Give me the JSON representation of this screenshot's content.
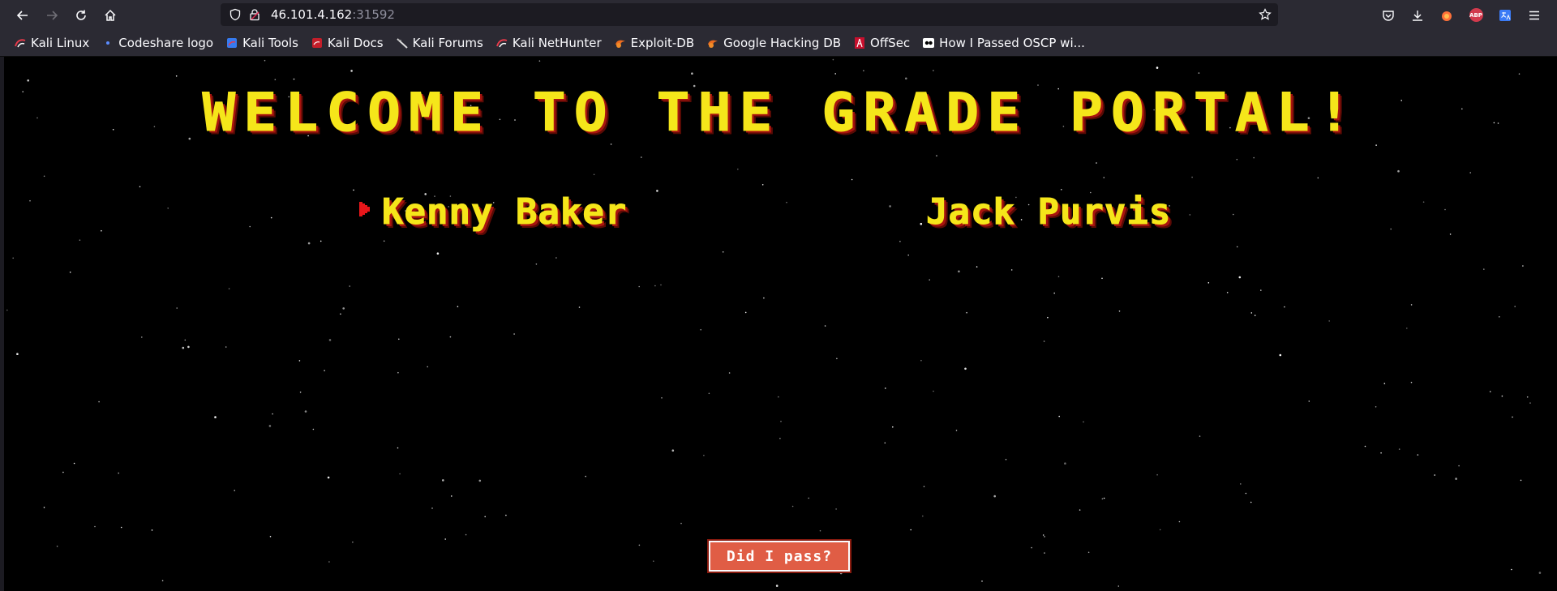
{
  "browser": {
    "url_host": "46.101.4.162",
    "url_port": ":31592",
    "abp_label": "ABP"
  },
  "bookmarks": [
    {
      "label": "Kali Linux",
      "icon": "kali-icon"
    },
    {
      "label": "Codeshare logo",
      "icon": "dot-icon"
    },
    {
      "label": "Kali Tools",
      "icon": "kali-tools-icon"
    },
    {
      "label": "Kali Docs",
      "icon": "kali-docs-icon"
    },
    {
      "label": "Kali Forums",
      "icon": "kali-forums-icon"
    },
    {
      "label": "Kali NetHunter",
      "icon": "kali-icon"
    },
    {
      "label": "Exploit-DB",
      "icon": "exploitdb-icon"
    },
    {
      "label": "Google Hacking DB",
      "icon": "exploitdb-icon"
    },
    {
      "label": "OffSec",
      "icon": "offsec-icon"
    },
    {
      "label": "How I Passed OSCP wi...",
      "icon": "video-icon"
    }
  ],
  "page": {
    "title": "WELCOME TO THE GRADE PORTAL!",
    "students": [
      "Kenny Baker",
      "Jack Purvis"
    ],
    "pass_button": "Did I pass?"
  },
  "colors": {
    "title_yellow": "#f5e61a",
    "shadow_red": "#a8140e",
    "button_red": "#e05d45",
    "background": "#000000"
  }
}
